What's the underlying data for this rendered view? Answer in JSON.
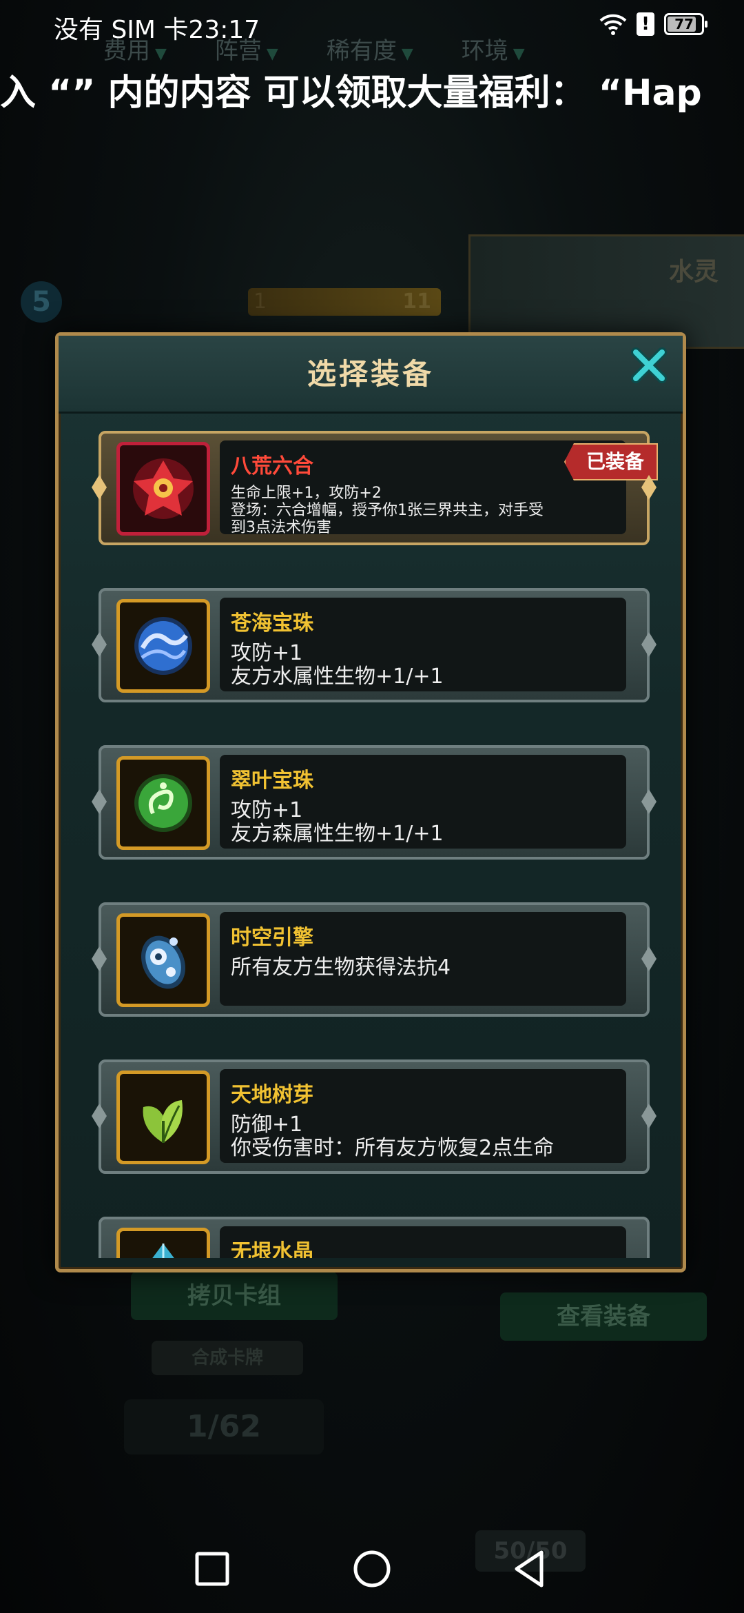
{
  "status_bar": {
    "carrier_time": "没有 SIM 卡23:17",
    "battery_level": "77"
  },
  "marquee": {
    "text": "入 “” 内的内容 可以领取大量福利： “Hap"
  },
  "modal": {
    "title": "选择装备"
  },
  "equipment": [
    {
      "name": "八荒六合",
      "desc": "生命上限+1，攻防+2\n登场：六合增幅，授予你1张三界共主，对手受\n到3点法术伤害",
      "equipped": true,
      "tag": "已装备",
      "icon": "crimson-emblem-icon",
      "icon_color": "#e0323a"
    },
    {
      "name": "苍海宝珠",
      "desc": "攻防+1\n友方水属性生物+1/+1",
      "equipped": false,
      "icon": "blue-orb-icon",
      "icon_color": "#2f6fd0"
    },
    {
      "name": "翠叶宝珠",
      "desc": "攻防+1\n友方森属性生物+1/+1",
      "equipped": false,
      "icon": "green-orb-icon",
      "icon_color": "#3aa63a"
    },
    {
      "name": "时空引擎",
      "desc": "所有友方生物获得法抗4",
      "equipped": false,
      "icon": "time-engine-icon",
      "icon_color": "#4a90c8"
    },
    {
      "name": "天地树芽",
      "desc": "防御+1\n你受伤害时：所有友方恢复2点生命",
      "equipped": false,
      "icon": "leaf-sprout-icon",
      "icon_color": "#8cc43a"
    },
    {
      "name": "无垠水晶",
      "desc": "",
      "equipped": false,
      "icon": "crystal-icon",
      "icon_color": "#3ab0d0"
    }
  ],
  "background": {
    "filter_labels": [
      "费用",
      "阵营",
      "稀有度",
      "环境"
    ],
    "hero_name": "水灵",
    "level_value": "11",
    "level_label": "1",
    "badge_value": "5",
    "copy_deck_label": "拷贝卡组",
    "view_equipment_label": "查看装备",
    "craft_card_label": "合成卡牌",
    "card_count": "1/62",
    "deck_count": "50/50"
  },
  "colors": {
    "modal_border": "#b08a4c",
    "title": "#f0d9a8",
    "name_normal": "#f1c232",
    "name_selected": "#ff4a3a",
    "close_icon": "#3fd1d4",
    "equipped_tag": "#b52b2b"
  }
}
